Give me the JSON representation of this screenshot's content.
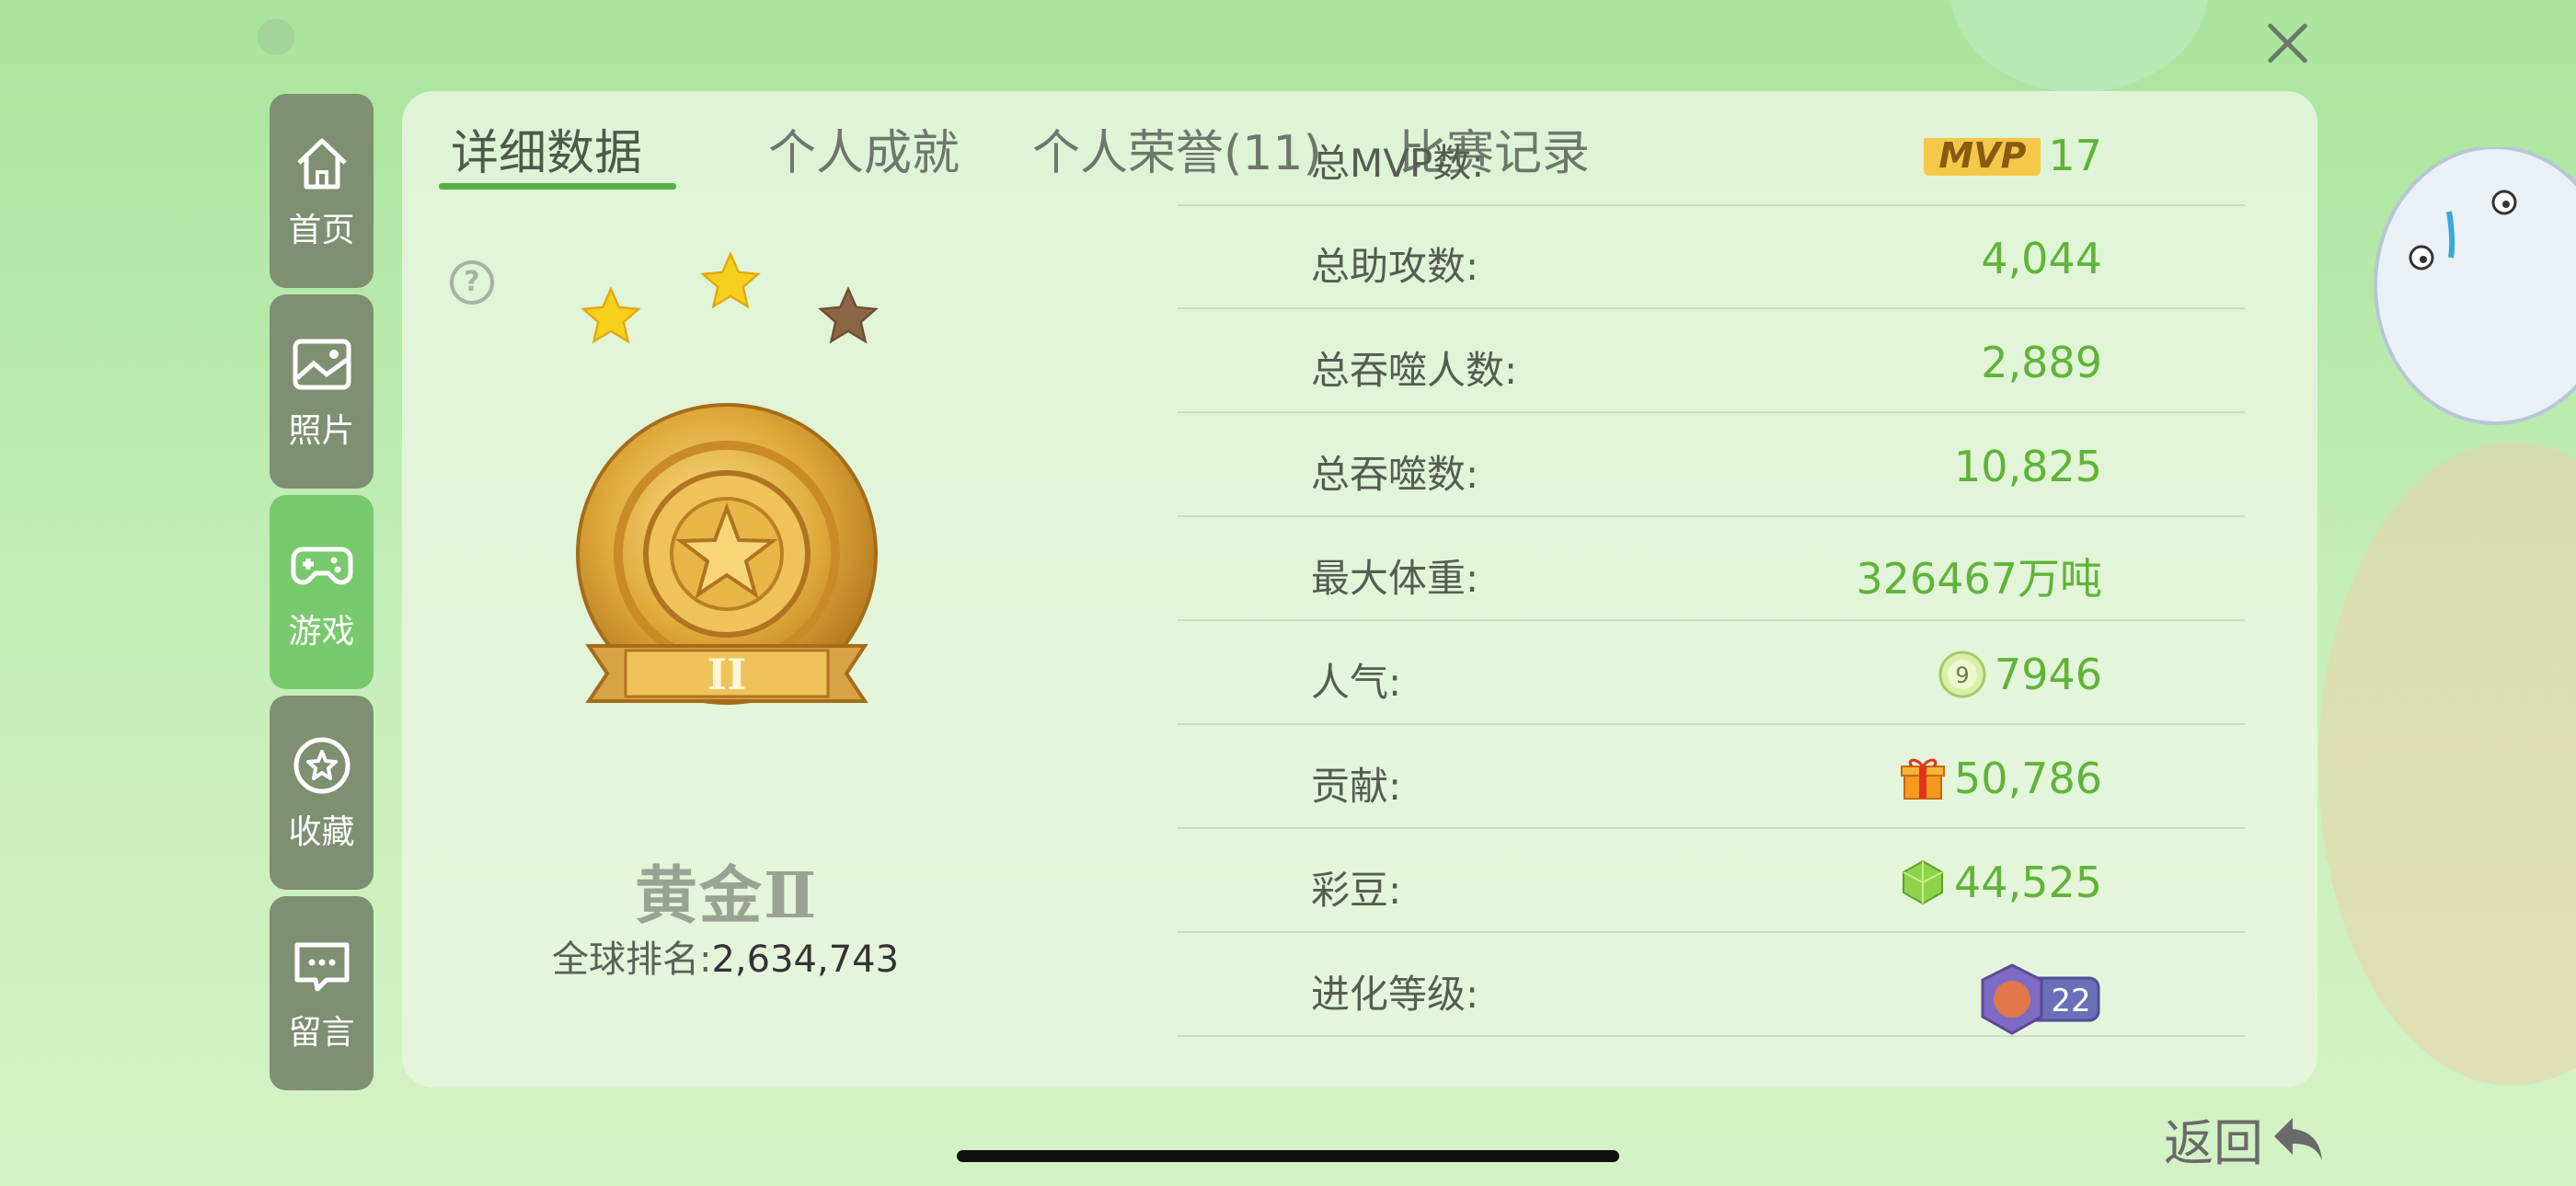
{
  "sidebar": {
    "items": [
      {
        "label": "首页",
        "icon": "home-icon",
        "active": false
      },
      {
        "label": "照片",
        "icon": "photo-icon",
        "active": false
      },
      {
        "label": "游戏",
        "icon": "gamepad-icon",
        "active": true
      },
      {
        "label": "收藏",
        "icon": "star-icon",
        "active": false
      },
      {
        "label": "留言",
        "icon": "message-icon",
        "active": false
      }
    ]
  },
  "tabs": [
    {
      "label": "详细数据",
      "active": true
    },
    {
      "label": "个人成就",
      "active": false
    },
    {
      "label": "个人荣誉(11)",
      "active": false
    },
    {
      "label": "比赛记录",
      "active": false
    }
  ],
  "rank": {
    "title": "黄金Ⅱ",
    "ribbon_text": "II",
    "global_label": "全球排名:",
    "global_value": "2,634,743",
    "stars_filled": 2,
    "stars_total": 3
  },
  "stats": [
    {
      "label": "总MVP数:",
      "value": "17",
      "badge": "MVP"
    },
    {
      "label": "总助攻数:",
      "value": "4,044"
    },
    {
      "label": "总吞噬人数:",
      "value": "2,889"
    },
    {
      "label": "总吞噬数:",
      "value": "10,825"
    },
    {
      "label": "最大体重:",
      "value": "326467万吨"
    },
    {
      "label": "人气:",
      "value": "7946",
      "icon_text": "9"
    },
    {
      "label": "贡献:",
      "value": "50,786"
    },
    {
      "label": "彩豆:",
      "value": "44,525"
    },
    {
      "label": "进化等级:",
      "value": "22"
    }
  ],
  "back_label": "返回",
  "colors": {
    "accent_green": "#5fb437",
    "sidebar_bg": "#7e8f72",
    "sidebar_active": "#78c96d",
    "tab_underline": "#55b045"
  }
}
